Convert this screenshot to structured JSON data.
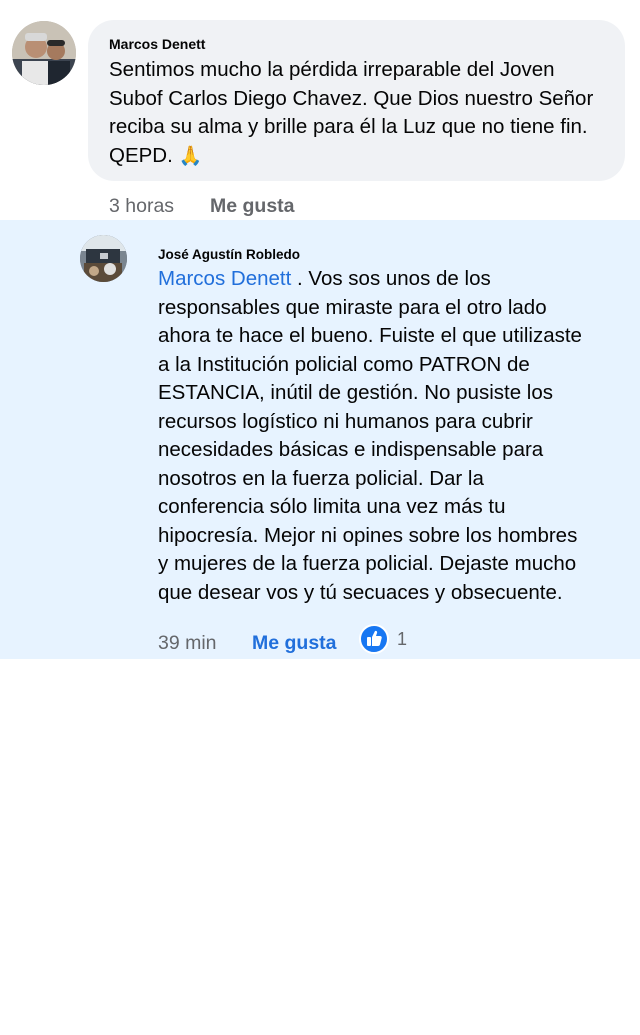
{
  "comment": {
    "author": "Marcos Denett",
    "text": "Sentimos mucho la pérdida irreparable del Joven\nSubof Carlos Diego Chavez. Que Dios nuestro Señor\nreciba su alma y brille para él la Luz que no tiene fin.\nQEPD.",
    "emoji": "🙏",
    "time": "3 horas",
    "like_label": "Me gusta"
  },
  "reply": {
    "author": "José Agustín Robledo",
    "mention": "Marcos Denett",
    "text": " . Vos sos unos de los\nresponsables que miraste para el otro lado\nahora te hace el bueno. Fuiste el que utilizaste\na la Institución policial como PATRON de\nESTANCIA,  inútil de gestión.  No pusiste los\nrecursos logístico ni humanos para cubrir\nnecesidades básicas e indispensable para\nnosotros en la fuerza policial.  Dar la\nconferencia sólo limita una vez más  tu\nhipocresía.  Mejor ni opines sobre los hombres\ny mujeres de la fuerza policial.  Dejaste mucho\nque desear vos y tú secuaces y obsecuente.",
    "time": "39 min",
    "like_label": "Me gusta",
    "reaction_count": "1",
    "reaction_icon": "like-thumb-icon"
  },
  "colors": {
    "link_blue": "#216fdb",
    "bubble": "#f0f2f5",
    "highlight": "#e7f3ff",
    "meta_gray": "#65676b",
    "like_badge": "#1877f2"
  }
}
